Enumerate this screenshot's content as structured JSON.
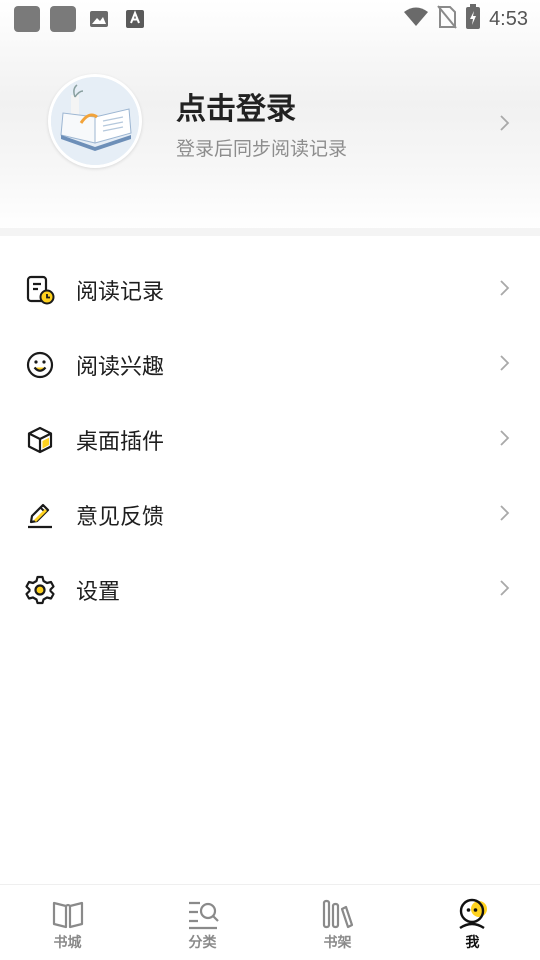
{
  "status_bar": {
    "time": "4:53",
    "left_icons": [
      "app-notification-icon",
      "app-notification-icon",
      "image-icon",
      "text-a-icon"
    ],
    "right_icons": [
      "wifi-icon",
      "no-sim-icon",
      "battery-charging-icon"
    ]
  },
  "profile": {
    "title": "点击登录",
    "subtitle": "登录后同步阅读记录"
  },
  "menu": {
    "items": [
      {
        "label": "阅读记录",
        "icon": "reading-history-icon"
      },
      {
        "label": "阅读兴趣",
        "icon": "smiley-icon"
      },
      {
        "label": "桌面插件",
        "icon": "cube-icon"
      },
      {
        "label": "意见反馈",
        "icon": "pencil-icon"
      },
      {
        "label": "设置",
        "icon": "gear-icon"
      }
    ]
  },
  "bottom_nav": {
    "tabs": [
      {
        "label": "书城",
        "icon": "open-book-icon"
      },
      {
        "label": "分类",
        "icon": "category-search-icon"
      },
      {
        "label": "书架",
        "icon": "bookshelf-icon"
      },
      {
        "label": "我",
        "icon": "profile-face-icon"
      }
    ],
    "active": "我"
  },
  "colors": {
    "accent": "#ffd21f",
    "text_primary": "#1e1e1e",
    "text_secondary": "#8d8d8d",
    "inactive_tab": "#8a8a8a"
  }
}
